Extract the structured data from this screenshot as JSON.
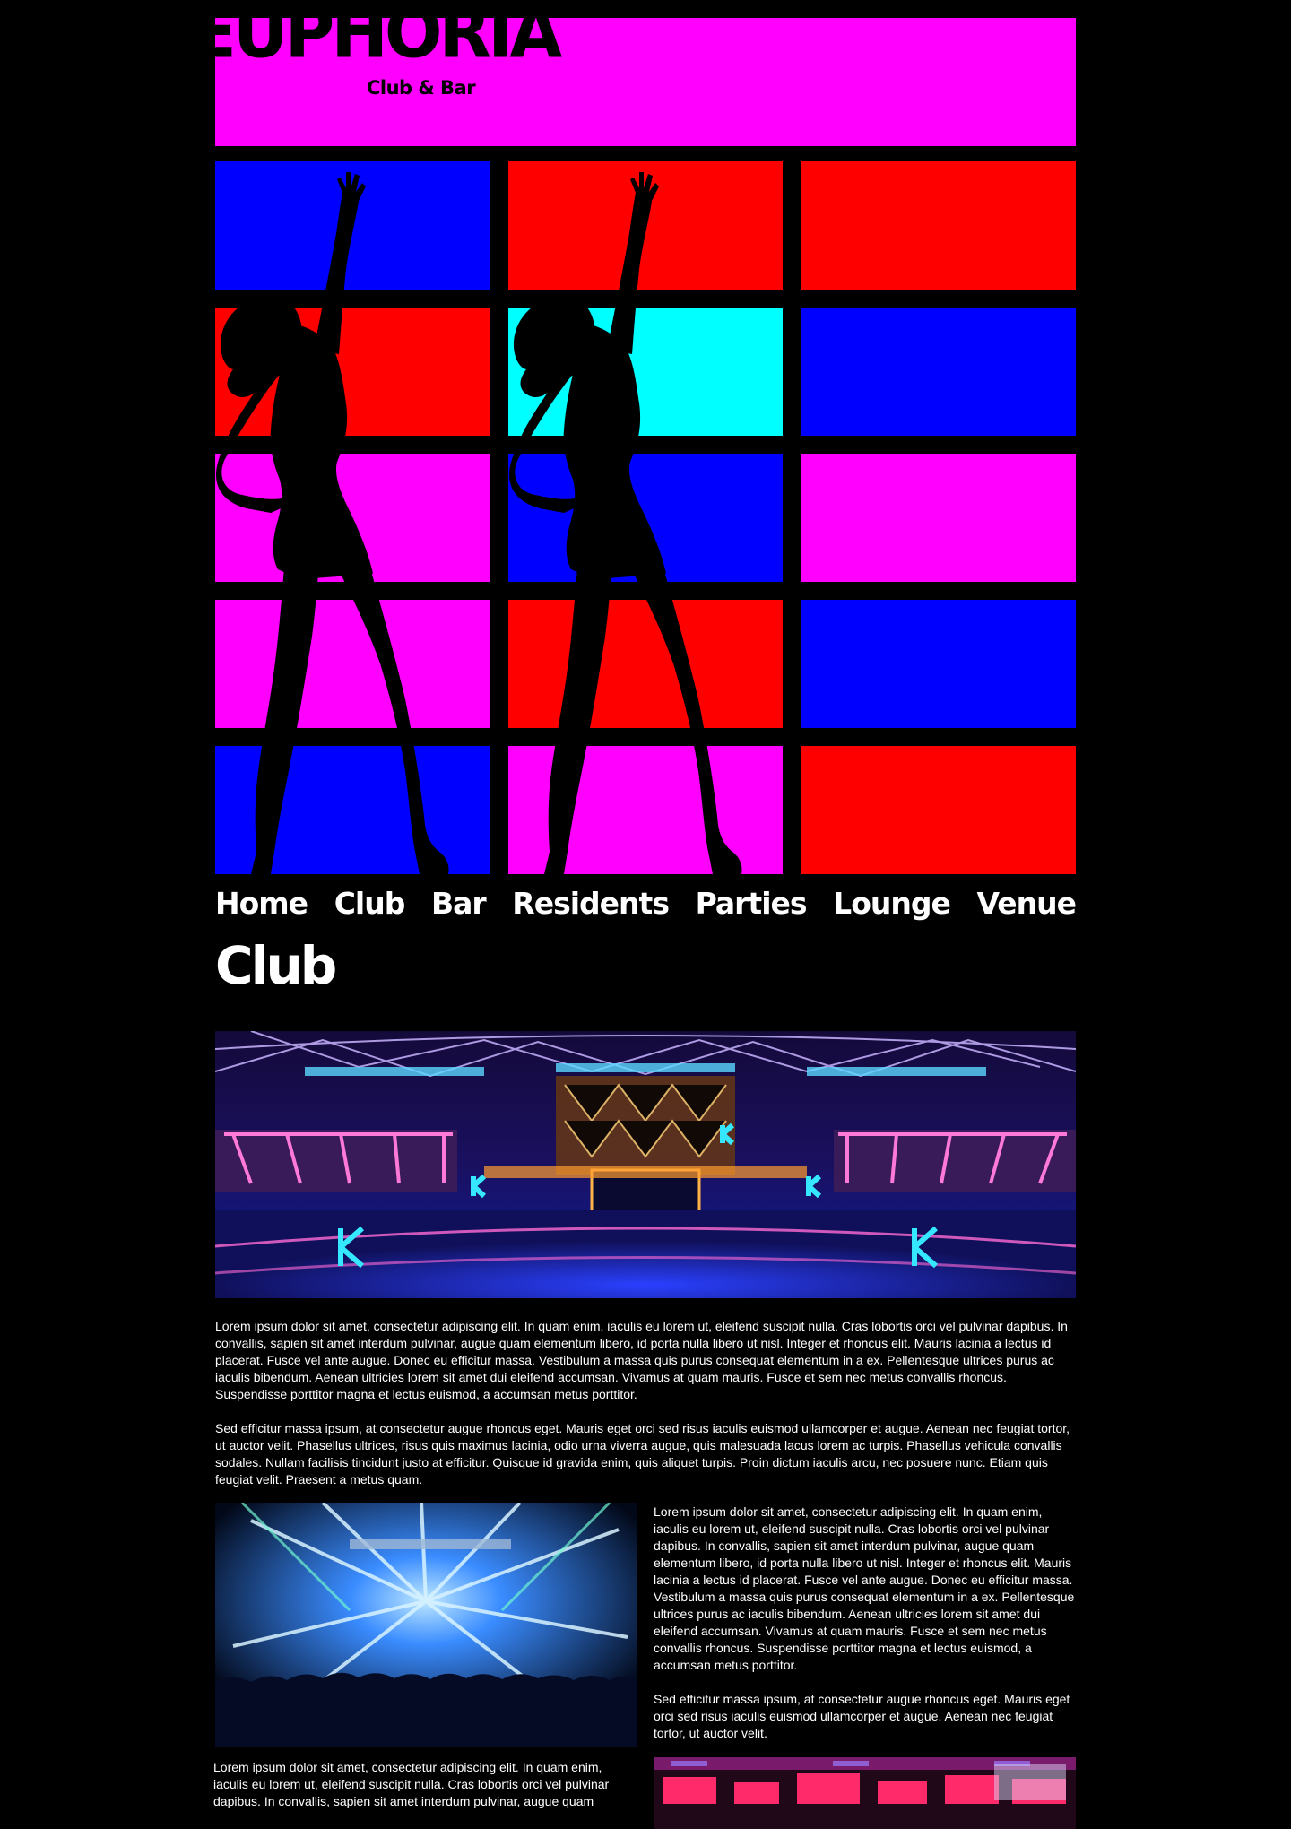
{
  "site": {
    "logo_text": "EUPHORIA",
    "tagline": "Club & Bar"
  },
  "hero": {
    "tile_colors": [
      [
        "#0000ff",
        "#ff0000",
        "#ff0000"
      ],
      [
        "#ff0000",
        "#00ffff",
        "#0000ff"
      ],
      [
        "#ff00ff",
        "#0000ff",
        "#ff00ff"
      ],
      [
        "#ff00ff",
        "#ff0000",
        "#0000ff"
      ],
      [
        "#0000ff",
        "#ff00ff",
        "#ff0000"
      ]
    ],
    "silhouette_count": 2
  },
  "nav": {
    "items": [
      "Home",
      "Club",
      "Bar",
      "Residents",
      "Parties",
      "Lounge",
      "Venue"
    ]
  },
  "main": {
    "title": "Club",
    "paragraphs": [
      "Lorem ipsum dolor sit amet, consectetur adipiscing elit. In quam enim, iaculis eu lorem ut, eleifend suscipit nulla. Cras lobortis orci vel pulvinar dapibus. In convallis, sapien sit amet interdum pulvinar, augue quam elementum libero, id porta nulla libero ut nisl. Integer et rhoncus elit. Mauris lacinia a lectus id placerat. Fusce vel ante augue. Donec eu efficitur massa. Vestibulum a massa quis purus consequat elementum in a ex. Pellentesque ultrices purus ac iaculis bibendum. Aenean ultricies lorem sit amet dui eleifend accumsan. Vivamus at quam mauris. Fusce et sem nec metus convallis rhoncus. Suspendisse porttitor magna et lectus euismod, a accumsan metus porttitor.",
      "Sed efficitur massa ipsum, at consectetur augue rhoncus eget. Mauris eget orci sed risus iaculis euismod ullamcorper et augue. Aenean nec feugiat tortor, ut auctor velit. Phasellus ultrices, risus quis maximus lacinia, odio urna viverra augue, quis malesuada lacus lorem ac turpis. Phasellus vehicula convallis sodales. Nullam facilisis tincidunt justo at efficitur. Quisque id gravida enim, quis aliquet turpis. Proin dictum iaculis arcu, nec posuere nunc. Etiam quis feugiat velit. Praesent a metus quam.",
      "Lorem ipsum dolor sit amet, consectetur adipiscing elit. In quam enim, iaculis eu lorem ut, eleifend suscipit nulla. Cras lobortis orci vel pulvinar dapibus. In convallis, sapien sit amet interdum pulvinar, augue quam elementum libero, id porta nulla libero ut nisl. Integer et rhoncus elit. Mauris lacinia a lectus id placerat. Fusce vel ante augue. Donec eu efficitur massa. Vestibulum a massa quis purus consequat elementum in a ex. Pellentesque ultrices purus ac iaculis bibendum. Aenean ultricies lorem sit amet dui eleifend accumsan. Vivamus at quam mauris. Fusce et sem nec metus convallis rhoncus. Suspendisse porttitor magna et lectus euismod, a accumsan metus porttitor.",
      "Sed efficitur massa ipsum, at consectetur augue rhoncus eget. Mauris eget orci sed risus iaculis euismod ullamcorper et augue. Aenean nec feugiat tortor, ut auctor velit.",
      "Lorem ipsum dolor sit amet, consectetur adipiscing elit. In quam enim, iaculis eu lorem ut, eleifend suscipit nulla. Cras lobortis orci vel pulvinar dapibus. In convallis, sapien sit amet interdum pulvinar, augue quam"
    ]
  },
  "colors": {
    "background": "#000000",
    "header": "#ff00ff",
    "text": "#ffffff",
    "blue": "#0000ff",
    "red": "#ff0000",
    "magenta": "#ff00ff",
    "cyan": "#00ffff"
  }
}
